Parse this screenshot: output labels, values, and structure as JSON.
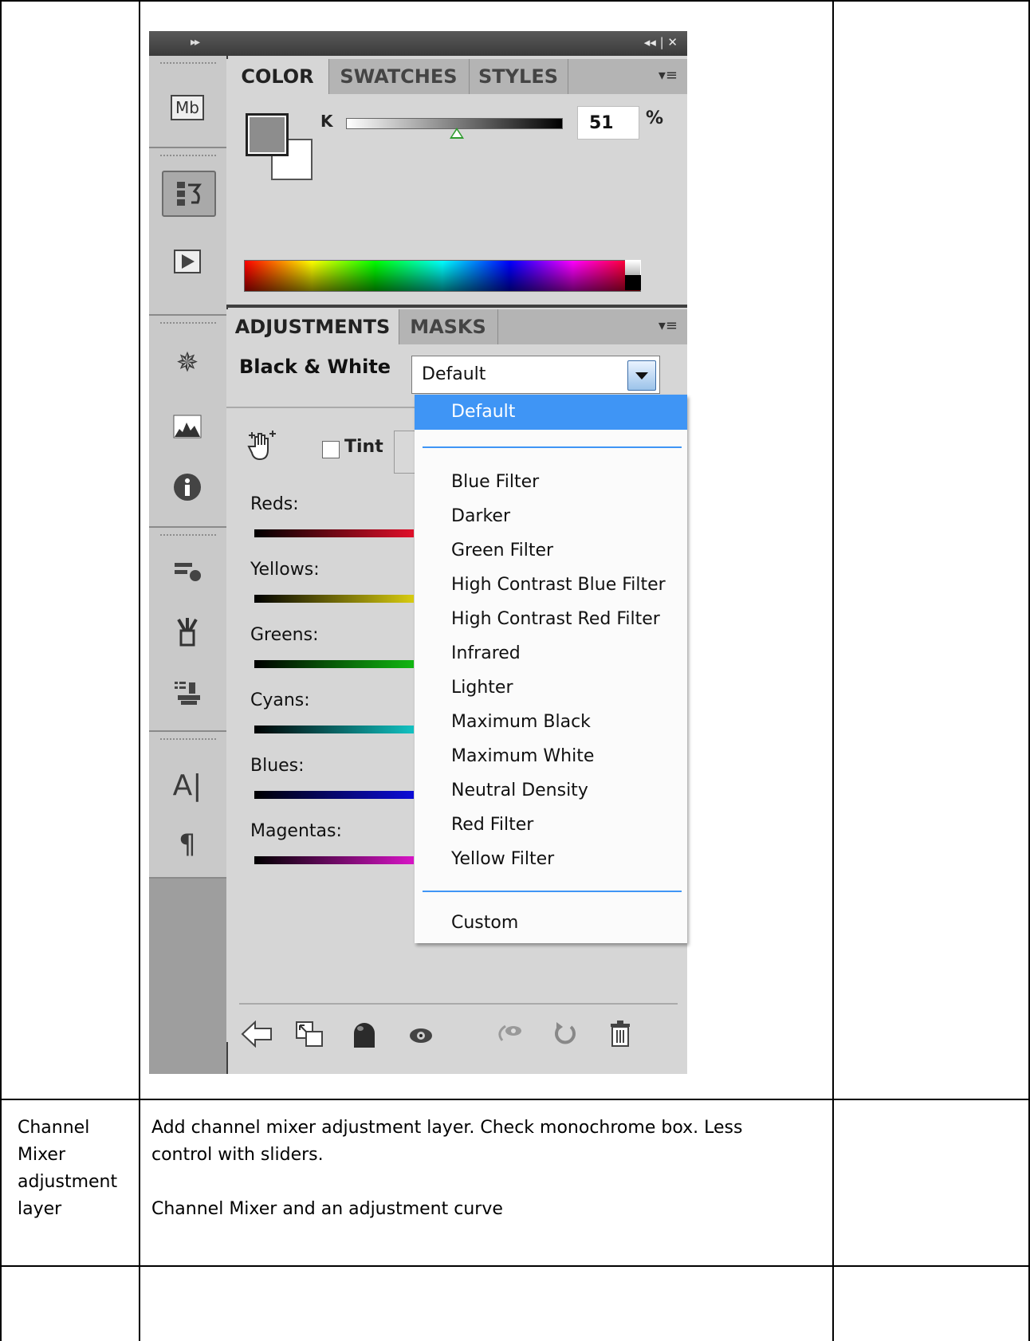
{
  "panel": {
    "title_left_glyph": "▸▸",
    "title_right_glyphs": "◂◂ | ✕",
    "dock_icons": [
      "mini-bridge-icon",
      "history-icon",
      "actions-icon",
      "navigator-icon",
      "histogram-icon",
      "info-icon",
      "brush-presets-icon",
      "brushes-icon",
      "clone-source-icon",
      "character-icon",
      "paragraph-icon"
    ],
    "dock_mb_text": "Mb",
    "color_tabs": [
      "COLOR",
      "SWATCHES",
      "STYLES"
    ],
    "k_label": "K",
    "k_value": "51",
    "k_unit": "%",
    "k_level_percent": 51,
    "adj_tabs": [
      "ADJUSTMENTS",
      "MASKS"
    ],
    "preset_label": "Black & White",
    "preset_value": "Default",
    "tint_label": "Tint",
    "sliders": [
      {
        "label": "Reds:",
        "color": "#e0102a"
      },
      {
        "label": "Yellows:",
        "color": "#d8cc10"
      },
      {
        "label": "Greens:",
        "color": "#11b711"
      },
      {
        "label": "Cyans:",
        "color": "#12c2c2"
      },
      {
        "label": "Blues:",
        "color": "#0c0cd8"
      },
      {
        "label": "Magentas:",
        "color": "#d814c6"
      }
    ],
    "bottom_icons": [
      "back-arrow-icon",
      "clip-layer-icon",
      "layer-mask-icon",
      "visibility-eye-icon",
      "view-previous-icon",
      "reset-icon",
      "trash-icon"
    ]
  },
  "dropdown": {
    "selected": "Default",
    "options": [
      "Blue Filter",
      "Darker",
      "Green Filter",
      "High Contrast Blue Filter",
      "High Contrast Red Filter",
      "Infrared",
      "Lighter",
      "Maximum Black",
      "Maximum White",
      "Neutral Density",
      "Red Filter",
      "Yellow Filter"
    ],
    "custom": "Custom"
  },
  "table": {
    "row2_col1": [
      "Channel",
      "Mixer",
      "adjustment",
      "layer"
    ],
    "row2_col2_line1": "Add channel mixer adjustment layer.  Check monochrome box. Less",
    "row2_col2_line2": "control with sliders.",
    "row2_col2_line3": "Channel Mixer and an adjustment  curve"
  }
}
